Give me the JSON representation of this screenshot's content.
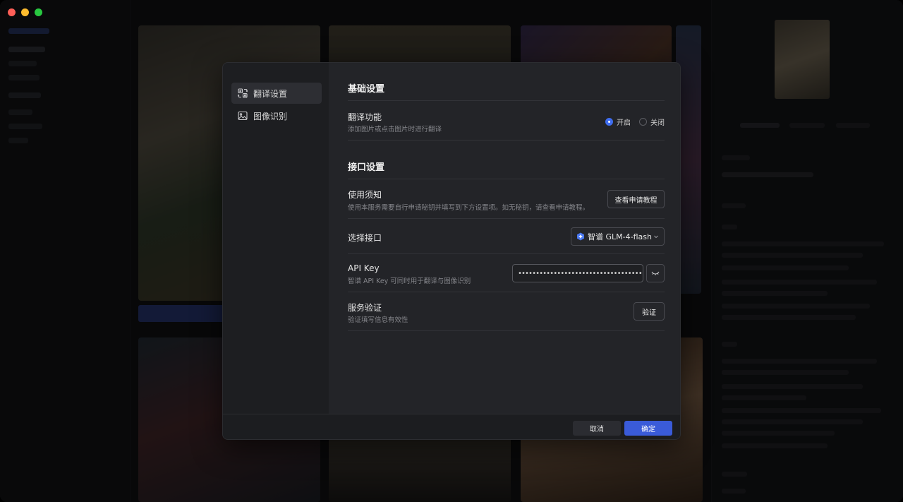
{
  "dialog": {
    "nav": [
      {
        "label": "翻译设置",
        "icon": "translate-icon",
        "active": true
      },
      {
        "label": "图像识别",
        "icon": "image-icon",
        "active": false
      }
    ],
    "basic": {
      "title": "基础设置",
      "translate_label": "翻译功能",
      "translate_desc": "添加图片或点击图片时进行翻译",
      "options": [
        {
          "label": "开启",
          "selected": true
        },
        {
          "label": "关闭",
          "selected": false
        }
      ]
    },
    "api": {
      "title": "接口设置",
      "notice_label": "使用须知",
      "notice_desc": "使用本服务需要自行申请秘钥并填写到下方设置项。如无秘钥，请查看申请教程。",
      "tutorial_button": "查看申请教程",
      "select_label": "选择接口",
      "select_value": "智谱 GLM-4-flash",
      "key_label": "API Key",
      "key_desc": "智谱 API Key 可同时用于翻译与图像识别",
      "key_value": "••••••••••••••••••••••••••••••••••••••••••••••••••••",
      "verify_label": "服务验证",
      "verify_desc": "验证填写信息有效性",
      "verify_button": "验证"
    },
    "footer": {
      "cancel": "取消",
      "ok": "确定"
    }
  },
  "colors": {
    "accent": "#3a5bd9",
    "radio_on": "#3f6df0",
    "close": "#ef5b52"
  }
}
